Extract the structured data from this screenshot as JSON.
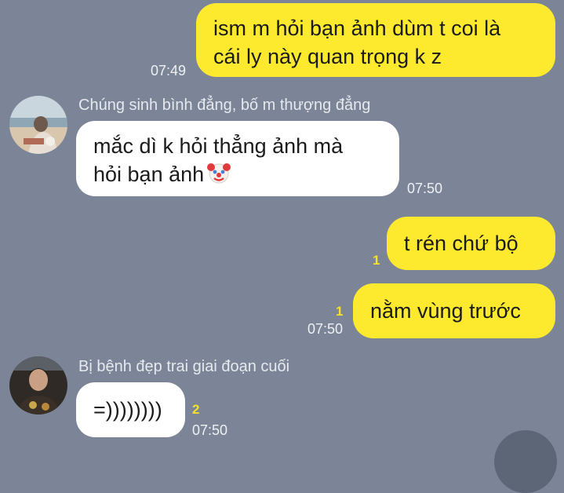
{
  "messages": [
    {
      "lines": [
        "ism m hỏi bạn ảnh dùm t coi là",
        "cái ly này quan trọng k z"
      ],
      "time": "07:49"
    },
    {
      "sender": "Chúng sinh bình đẳng, bố m thượng đẳng",
      "lines": [
        "mắc dì k hỏi thẳng ảnh mà",
        "hỏi bạn ảnh"
      ],
      "emoji": "clown-face",
      "time": "07:50"
    },
    {
      "lines": [
        "t rén chứ bộ"
      ],
      "unread": "1"
    },
    {
      "lines": [
        "nằm vùng trước"
      ],
      "unread": "1",
      "time": "07:50"
    },
    {
      "sender": "Bị bệnh đẹp trai giai đoạn cuối",
      "lines": [
        "=))))))))"
      ],
      "unread": "2",
      "time": "07:50"
    }
  ],
  "colors": {
    "background": "#7b8597",
    "my_bubble": "#fdea2f",
    "their_bubble": "#ffffff",
    "unread_count": "#f5e12a"
  }
}
